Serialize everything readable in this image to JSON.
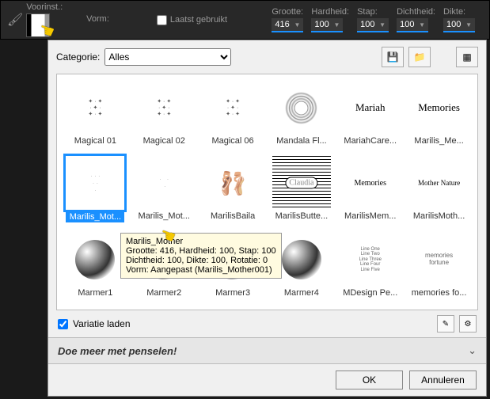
{
  "topbar": {
    "preset_label": "Voorinst.:",
    "shape_label": "Vorm:",
    "last_used_label": "Laatst gebruikt",
    "params": {
      "size_label": "Grootte:",
      "size_value": "416",
      "hardness_label": "Hardheid:",
      "hardness_value": "100",
      "step_label": "Stap:",
      "step_value": "100",
      "density_label": "Dichtheid:",
      "density_value": "100",
      "thickness_label": "Dikte:",
      "thickness_value": "100"
    }
  },
  "dialog": {
    "category_label": "Categorie:",
    "category_value": "Alles",
    "variation_label": "Variatie laden",
    "promo_text": "Doe meer met penselen!",
    "ok_label": "OK",
    "cancel_label": "Annuleren"
  },
  "tooltip": {
    "line1": "Marilis_Mother",
    "line2": "Grootte: 416, Hardheid: 100, Stap: 100",
    "line3": "Dichtheid: 100, Dikte: 100, Rotatie: 0",
    "line4": "Vorm: Aangepast (Marilis_Mother001)"
  },
  "presets": [
    {
      "name": "Magical 01"
    },
    {
      "name": "Magical 02"
    },
    {
      "name": "Magical 06"
    },
    {
      "name": "Mandala Fl..."
    },
    {
      "name": "MariahCare..."
    },
    {
      "name": "Marilis_Me..."
    },
    {
      "name": "Marilis_Mot..."
    },
    {
      "name": "Marilis_Mot..."
    },
    {
      "name": "MarilisBaila"
    },
    {
      "name": "MarilisButte..."
    },
    {
      "name": "MarilisMem..."
    },
    {
      "name": "MarilisMoth..."
    },
    {
      "name": "Marmer1"
    },
    {
      "name": "Marmer2"
    },
    {
      "name": "Marmer3"
    },
    {
      "name": "Marmer4"
    },
    {
      "name": "MDesign Pe..."
    },
    {
      "name": "memories fo..."
    }
  ],
  "selected_index": 6,
  "thumb_text": {
    "memories": "Memories",
    "claudia": "Claudia",
    "mother_nature": "Mother Nature",
    "memories2": "Memories",
    "butterfly": "✿✿✿",
    "md_lines": "Line One\nLine Two\nLine Three\nLine Four\nLine Five",
    "fortune": "memories\nfortune"
  }
}
